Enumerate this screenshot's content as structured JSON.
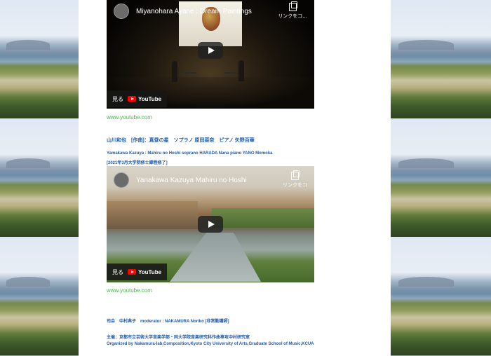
{
  "video1": {
    "title": "Miyanohara Ayane : Dream Paintings",
    "share_label": "リンクをコ...",
    "watch_label": "見る",
    "logo_text": "YouTube"
  },
  "link1": "www.youtube.com",
  "work_line_ja": "山川和也　[作曲]：真昼の星　ソプラノ 原田菜奈　ピアノ 矢野百華",
  "work_line_en": "Yamakawa Kazuya : Mahiru no Hoshi  soprano HARADA Nana  piano YANO Momoka",
  "work_note": "[2021年3月大学院修士課程修了]",
  "video2": {
    "title": "Yanakawa Kazuya Mahiru no Hoshi",
    "share_label": "リンクをコ",
    "watch_label": "見る",
    "logo_text": "YouTube"
  },
  "link2": "www.youtube.com",
  "moderator": "司会　中村典子　moderator : NAKAMURA Noriko [非常勤講師]",
  "organizer_ja": "主催：京都市立芸術大学音楽学部・同大学院音楽研究科作曲専攻中村研究室",
  "organizer_en": "Organized by Nakamura-lab,Composition,Kyoto City University of Arts,Graduate School of Music,KCUA"
}
